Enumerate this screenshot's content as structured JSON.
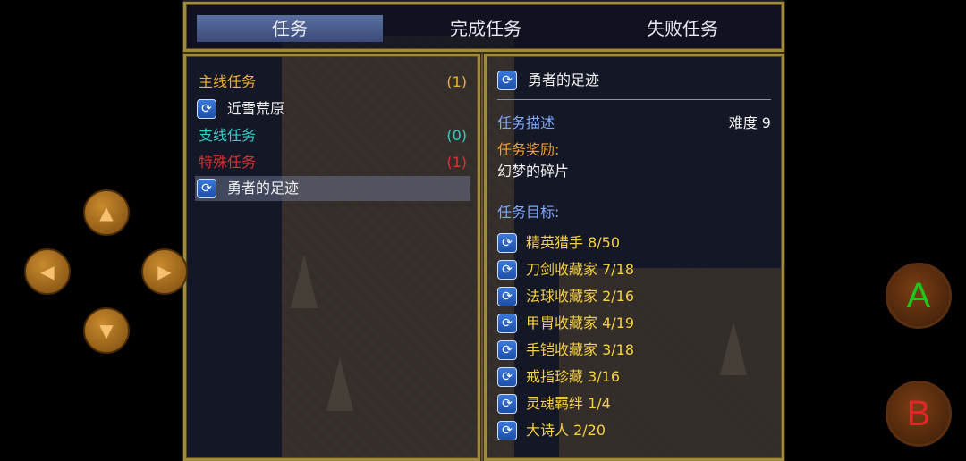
{
  "tabs": [
    {
      "label": "任务",
      "active": true
    },
    {
      "label": "完成任务",
      "active": false
    },
    {
      "label": "失败任务",
      "active": false
    }
  ],
  "quest_list": {
    "main": {
      "label": "主线任务",
      "count": "(1)",
      "color": "#f0b030"
    },
    "main_items": [
      "近雪荒原"
    ],
    "side": {
      "label": "支线任务",
      "count": "(0)",
      "color": "#30d0c8"
    },
    "special": {
      "label": "特殊任务",
      "count": "(1)",
      "color": "#e03030"
    },
    "special_items": [
      "勇者的足迹"
    ]
  },
  "detail": {
    "title": "勇者的足迹",
    "desc_label": "任务描述",
    "difficulty": "难度 9",
    "reward_label": "任务奖励:",
    "reward": "幻梦的碎片",
    "goal_label": "任务目标:",
    "goals": [
      "精英猎手 8/50",
      "刀剑收藏家 7/18",
      "法球收藏家 2/16",
      "甲胄收藏家 4/19",
      "手铠收藏家 3/18",
      "戒指珍藏 3/16",
      "灵魂羁绊 1/4",
      "大诗人 2/20"
    ]
  },
  "controls": {
    "up": "▲",
    "left": "◀",
    "right": "▶",
    "down": "▼",
    "a": "A",
    "b": "B",
    "a_color": "#1cc81c",
    "b_color": "#e02828"
  },
  "colors": {
    "label_blue": "#7fa8ff",
    "reward_orange": "#f0a030",
    "goal_yellow": "#f5d040"
  }
}
